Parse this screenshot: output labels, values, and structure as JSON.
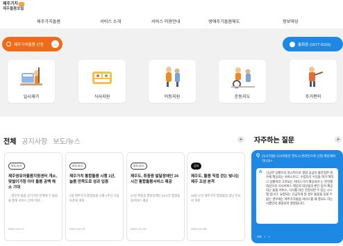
{
  "header": {
    "logo_line1": "제주가치",
    "logo_line2": "제주돌봄포털",
    "nav": [
      "제주가치돌봄",
      "서비스 소개",
      "서비스 이용안내",
      "생애주기돌봄체도",
      "정보마당"
    ]
  },
  "actions": {
    "apply_label": "제주가치돌봄 신청",
    "call_label": "통화중 (1577-9110)"
  },
  "services": [
    {
      "label": "일시재가",
      "icon": "housework-icon"
    },
    {
      "label": "식사지원",
      "icon": "meal-icon"
    },
    {
      "label": "이동지원",
      "icon": "mobility-icon"
    },
    {
      "label": "운동지도",
      "icon": "exercise-icon"
    },
    {
      "label": "주거편의",
      "icon": "housing-icon"
    }
  ],
  "news": {
    "tabs": [
      "전체",
      "공지사항",
      "보도/뉴스"
    ],
    "more": "+",
    "cards": [
      {
        "tag": "보도/뉴스",
        "title": "제주영유아돌봄지원센터 개소, 맞벌이가정 아이 돌봄 공백 해소 기대",
        "excerpt": "…영유아 돌봄 공가기반 문제에 수 돌봄을 통해 서비스 전체 지원…",
        "date": "2024-10-17"
      },
      {
        "tag": "보도/뉴스",
        "title": "제주가치 통합돌봄 시행 1년, 늘봄 만족도로 성과 입증",
        "excerpt": "2일 제주가치 통합돌봄 시행 1주년 기념토론회 개최",
        "date": "2024-10-15"
      },
      {
        "tag": "보도/뉴스",
        "title": "제주도, 취중증 발달장애인 24시간 통합돌봄서비스 제공",
        "excerpt": "27일 취중증 발달장애인 24시간 통합돌봄서비스 제공",
        "date": "2024-10-15"
      },
      {
        "tag": "공지",
        "title": "제주도, 돌봄 직접 걷는 빛나는 제주 조성 본격",
        "excerpt": "18일 오전 제주가치 통합돌봄 빛난 진료서 개최",
        "date": "2024-10-08"
      }
    ]
  },
  "faq": {
    "title": "자주하는 질문",
    "more": "+",
    "question": "[식사지원] 식사지원은 한도시 온라인으로 신청 해당해야 하나요?",
    "answer": "긴급한 상황으로 일시적으로 생업 공급이 불안정한 경우에 해당되는 서비스이고, 수립자가 수입을 여기 여라고 상황이라 고려되는 서비스가가 해당되어 는 본인별 대상으로 식사서비스 제공자 대상들의 판단 등이 제공되는 돌봄 서비스, 식사를 대신 전달되면 수 있는 시스템 입니다. 요청되는 긴급하게 일 경우 돌봄을 등을 수 없는 경우에는 제주가치돌봄 서비스를 해 결되도 하는 시행안의 개정되어 결정됩니다.",
    "pager_page": "1/5",
    "pager_prev": "‹",
    "pager_next": "›"
  },
  "colors": {
    "accent_orange": "#ef6b1a",
    "accent_blue": "#1e88e5",
    "band_gray": "#f1f1f1"
  }
}
